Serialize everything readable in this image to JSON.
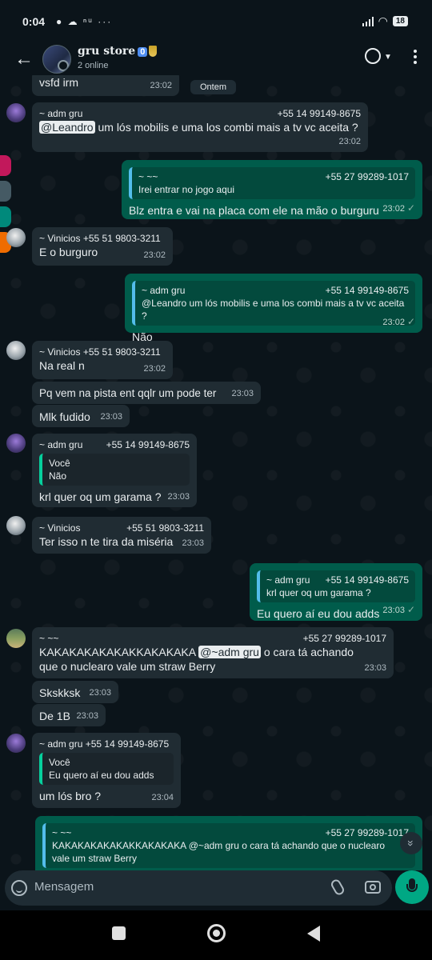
{
  "status_bar": {
    "time": "0:04",
    "notifications": "● ☁ ⁿᵘ ···",
    "battery": "18"
  },
  "header": {
    "title": "gru store",
    "badge": "0",
    "subtitle": "2 online"
  },
  "date_chip": "Ontem",
  "messages": [
    {
      "body": "vsfd irm",
      "time": "23:02"
    },
    {
      "sender": "~ adm gru",
      "phone": "+55 14 99149-8675",
      "mention": "@Leandro",
      "body": " um lós mobilis e uma los combi mais a tv vc aceita ?",
      "time": "23:02"
    },
    {
      "quote_name": "~ ~~",
      "quote_phone": "+55 27 99289-1017",
      "quote_text": "Irei entrar no jogo aqui",
      "body": "Blz entra e vai na placa com ele na mão o burguru",
      "time": "23:02"
    },
    {
      "sender": "~ Vinicios",
      "phone": "+55 51 9803-3211",
      "body": "E o burguro",
      "time": "23:02"
    },
    {
      "quote_name": "~ adm gru",
      "quote_phone": "+55 14 99149-8675",
      "quote_text": "@Leandro um lós mobilis e uma los combi mais a tv vc aceita ?",
      "body": "Não",
      "time": "23:02"
    },
    {
      "sender": "~ Vinicios",
      "phone": "+55 51 9803-3211",
      "body": "Na real n",
      "time": "23:02"
    },
    {
      "body": "Pq vem na pista ent qqlr um pode ter",
      "time": "23:03"
    },
    {
      "body": "Mlk fudido",
      "time": "23:03"
    },
    {
      "sender": "~ adm gru",
      "phone": "+55 14 99149-8675",
      "quote_name": "Você",
      "quote_text": "Não",
      "body": "krl quer oq um garama ?",
      "time": "23:03"
    },
    {
      "sender": "~ Vinicios",
      "phone": "+55 51 9803-3211",
      "body": "Ter isso n te tira da miséria",
      "time": "23:03"
    },
    {
      "quote_name": "~ adm gru",
      "quote_phone": "+55 14 99149-8675",
      "quote_text": "krl quer oq um garama ?",
      "body": "Eu quero aí eu dou adds",
      "time": "23:03"
    },
    {
      "sender": "~ ~~",
      "phone": "+55 27 99289-1017",
      "body_pre": "KAKAKAKAKAKAKKAKAKAKA ",
      "mention": "@~adm gru",
      "body": " o cara tá achando que o nuclearo vale um straw Berry",
      "time": "23:03"
    },
    {
      "body": "Skskksk",
      "time": "23:03"
    },
    {
      "body": "De 1B",
      "time": "23:03"
    },
    {
      "sender": "~ adm gru",
      "phone": "+55 14 99149-8675",
      "quote_name": "Você",
      "quote_text": "Eu quero aí eu dou adds",
      "body": "um lós bro ?",
      "time": "23:04"
    },
    {
      "quote_name": "~ ~~",
      "quote_phone": "+55 27 99289-1017",
      "quote_text": "KAKAKAKAKAKAKKAKAKAKA @~adm gru o cara tá achando que o nuclearo vale um straw Berry"
    }
  ],
  "composer": {
    "placeholder": "Mensagem"
  },
  "tick": "✓",
  "icons": {
    "back": "←",
    "scroll_down": "»"
  },
  "colors": {
    "accent": "#00a884",
    "incoming": "#202c33",
    "outgoing": "#005c4b",
    "background": "#0b141a"
  }
}
